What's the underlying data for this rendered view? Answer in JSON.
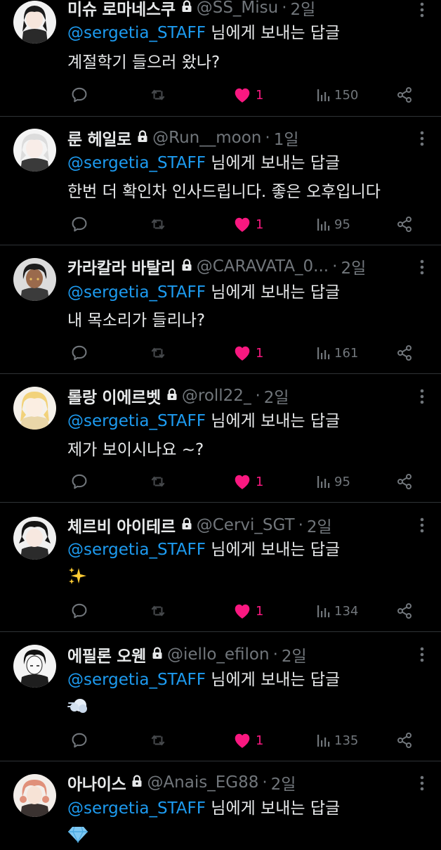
{
  "colors": {
    "background": "#000000",
    "text": "#e7e9ea",
    "muted": "#71767b",
    "mention": "#1d9bf0",
    "like": "#f91880",
    "divider": "#2f3336"
  },
  "reply_prefix": "@sergetia_STAFF",
  "reply_suffix": " 님에게 보내는 답글",
  "tweets": [
    {
      "display_name": "미슈 로마네스쿠",
      "handle": "@SS_Misu",
      "time": "2일",
      "text": "계절학기 들으러 왔나?",
      "likes": "1",
      "views": "150"
    },
    {
      "display_name": "룬 헤일로",
      "handle": "@Run__moon",
      "time": "1일",
      "text": "한번 더 확인차 인사드립니다. 좋은 오후입니다",
      "likes": "1",
      "views": "95"
    },
    {
      "display_name": "카라칼라 바탈리",
      "handle": "@CARAVATA_0...",
      "time": "2일",
      "text": "내 목소리가 들리나?",
      "likes": "1",
      "views": "161"
    },
    {
      "display_name": "롤랑 이에르벳",
      "handle": "@roll22_",
      "time": "2일",
      "text": "제가 보이시나요 ~?",
      "likes": "1",
      "views": "95"
    },
    {
      "display_name": "체르비 아이테르",
      "handle": "@Cervi_SGT",
      "time": "2일",
      "emoji": "sparkles-emoji",
      "likes": "1",
      "views": "134"
    },
    {
      "display_name": "에필론 오웬",
      "handle": "@iello_efilon",
      "time": "2일",
      "emoji": "dash-cloud-emoji",
      "likes": "1",
      "views": "135"
    },
    {
      "display_name": "아나이스",
      "handle": "@Anais_EG88",
      "time": "2일",
      "emoji": "gem-emoji"
    }
  ],
  "icons": {
    "lock": "lock-icon",
    "more": "more-icon",
    "reply": "reply-icon",
    "retweet": "retweet-icon",
    "like": "heart-filled-icon",
    "views": "views-bar-chart-icon",
    "share": "share-icon"
  }
}
